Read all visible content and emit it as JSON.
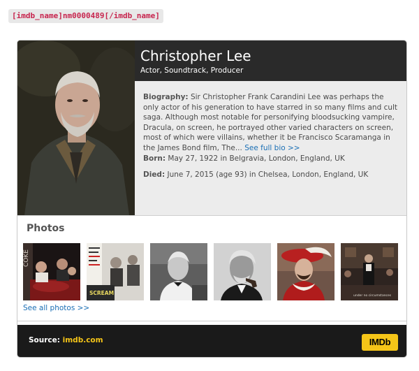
{
  "shortcode": "[imdb_name]nm0000489[/imdb_name]",
  "person": {
    "name": "Christopher Lee",
    "roles": "Actor, Soundtrack, Producer",
    "bio_label": "Biography:",
    "bio_text": " Sir Christopher Frank Carandini Lee was perhaps the only actor of his generation to have starred in so many films and cult saga. Although most notable for personifying bloodsucking vampire, Dracula, on screen, he portrayed other varied characters on screen, most of which were villains, whether it be Francisco Scaramanga in the James Bond film, The... ",
    "bio_link": "See full bio >>",
    "born_label": "Born:",
    "born_value": " May 27, 1922 in Belgravia, London, England, UK",
    "died_label": "Died:",
    "died_value": " June 7, 2015 (age 93) in Chelsea, London, England, UK"
  },
  "photos": {
    "title": "Photos",
    "see_all": "See all photos >>",
    "items": [
      {
        "name": "photo-1"
      },
      {
        "name": "photo-2"
      },
      {
        "name": "photo-3"
      },
      {
        "name": "photo-4"
      },
      {
        "name": "photo-5"
      },
      {
        "name": "photo-6"
      }
    ],
    "thumb_text": {
      "photo1_side": "COKE",
      "photo2_poster": "SCREAM",
      "photo6_caption": "under no circumstances"
    }
  },
  "footer": {
    "source_label": "Source:",
    "source_link": "imdb.com",
    "logo_text": "IMDb"
  },
  "colors": {
    "link": "#1a6fb5",
    "imdb_yellow": "#f5c518",
    "header_bg": "#2a2a2a",
    "footer_bg": "#1a1a1a",
    "bio_bg": "#ececec"
  }
}
